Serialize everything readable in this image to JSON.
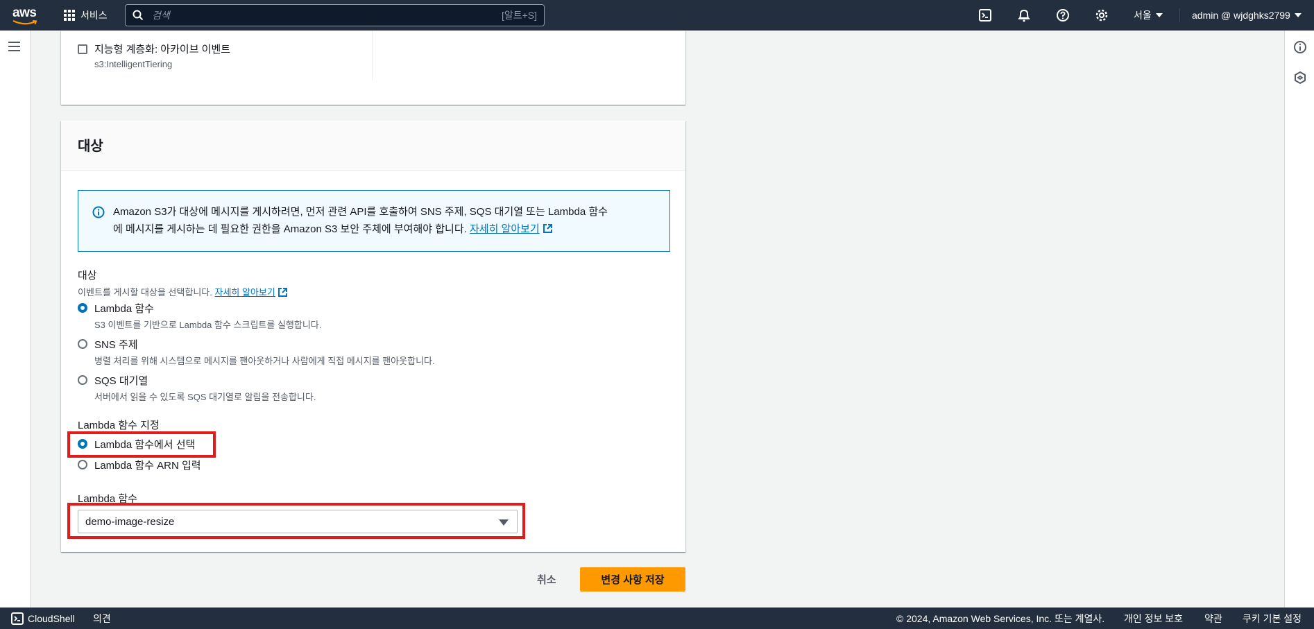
{
  "topnav": {
    "logo_text": "aws",
    "services_label": "서비스",
    "search_placeholder": "검색",
    "search_shortcut": "[알트+S]",
    "region_label": "서울",
    "account_label": "admin @ wjdghks2799",
    "icons": [
      "cloudshell-icon",
      "bell-icon",
      "help-icon",
      "settings-icon"
    ]
  },
  "event_types": {
    "intelligent_tiering": {
      "label": "지능형 계층화: 아카이브 이벤트",
      "sub": "s3:IntelligentTiering",
      "checked": false
    }
  },
  "destination": {
    "header": "대상",
    "info_text_1": "Amazon S3가 대상에 메시지를 게시하려면, 먼저 관련 API를 호출하여 SNS 주제, SQS 대기열 또는 Lambda 함수",
    "info_text_2": "에 메시지를 게시하는 데 필요한 권한을 Amazon S3 보안 주체에 부여해야 합니다.",
    "learn_more": "자세히 알아보기",
    "section_label": "대상",
    "section_desc": "이벤트를 게시할 대상을 선택합니다.",
    "options": [
      {
        "label": "Lambda 함수",
        "desc": "S3 이벤트를 기반으로 Lambda 함수 스크립트를 실행합니다.",
        "selected": true
      },
      {
        "label": "SNS 주제",
        "desc": "병렬 처리를 위해 시스템으로 메시지를 팬아웃하거나 사람에게 직접 메시지를 팬아웃합니다.",
        "selected": false
      },
      {
        "label": "SQS 대기열",
        "desc": "서버에서 읽을 수 있도록 SQS 대기열로 알림을 전송합니다.",
        "selected": false
      }
    ],
    "lambda_spec_label": "Lambda 함수 지정",
    "lambda_spec_options": [
      {
        "label": "Lambda 함수에서 선택",
        "selected": true
      },
      {
        "label": "Lambda 함수 ARN 입력",
        "selected": false
      }
    ],
    "lambda_function_label": "Lambda 함수",
    "lambda_function_value": "demo-image-resize"
  },
  "actions": {
    "cancel": "취소",
    "save": "변경 사항 저장"
  },
  "footer": {
    "cloudshell": "CloudShell",
    "feedback": "의견",
    "copyright": "© 2024, Amazon Web Services, Inc. 또는 계열사.",
    "privacy": "개인 정보 보호",
    "terms": "약관",
    "cookies": "쿠키 기본 설정"
  },
  "colors": {
    "nav_bg": "#232f3e",
    "accent": "#0073bb",
    "primary_button": "#ff9900",
    "highlight": "#e21b1b"
  }
}
